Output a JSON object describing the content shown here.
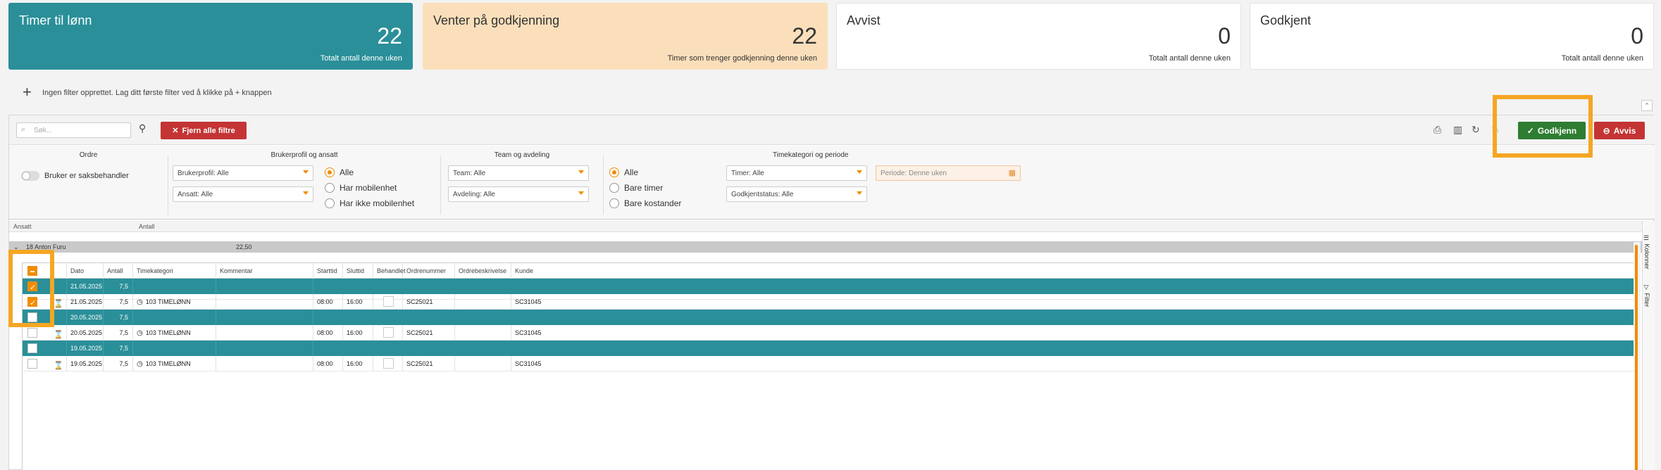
{
  "cards": [
    {
      "title": "Timer til lønn",
      "value": "22",
      "subtitle": "Totalt antall denne uken"
    },
    {
      "title": "Venter på godkjenning",
      "value": "22",
      "subtitle": "Timer som trenger godkjenning denne uken"
    },
    {
      "title": "Avvist",
      "value": "0",
      "subtitle": "Totalt antall denne uken"
    },
    {
      "title": "Godkjent",
      "value": "0",
      "subtitle": "Totalt antall denne uken"
    }
  ],
  "filter_notice": "Ingen filter opprettet. Lag ditt første filter ved å klikke på + knappen",
  "toolbar": {
    "search_placeholder": "Søk...",
    "clear_filters_label": "Fjern alle filtre",
    "approve_label": "Godkjenn",
    "reject_label": "Avvis"
  },
  "filters": {
    "ordre": {
      "heading": "Ordre",
      "toggle_label": "Bruker er saksbehandler"
    },
    "bruker": {
      "heading": "Brukerprofil og ansatt",
      "profile_select": "Brukerprofil: Alle",
      "employee_select": "Ansatt: Alle",
      "radios": [
        "Alle",
        "Har mobilenhet",
        "Har ikke mobilenhet"
      ]
    },
    "team": {
      "heading": "Team og avdeling",
      "team_select": "Team: Alle",
      "dept_select": "Avdeling: Alle"
    },
    "time": {
      "heading": "Timekategori og periode",
      "radios": [
        "Alle",
        "Bare timer",
        "Bare kostander"
      ],
      "timer_select": "Timer: Alle",
      "status_select": "Godkjentstatus: Alle",
      "period_select": "Periode: Denne uken"
    }
  },
  "group_header": {
    "col1": "Ansatt",
    "col2": "Antall"
  },
  "group_row": {
    "name": "18 Anton Furu",
    "total": "22,50"
  },
  "table": {
    "columns": [
      "Dato",
      "Antall",
      "Timekategori",
      "Kommentar",
      "Starttid",
      "Sluttid",
      "Behandlet",
      "Ordrenummer",
      "Ordrebeskrivelse",
      "Kunde"
    ],
    "rows": [
      {
        "type": "summary",
        "checked": true,
        "date": "21.05.2025",
        "amount": "7,5"
      },
      {
        "type": "detail",
        "checked": true,
        "date": "21.05.2025",
        "amount": "7,5",
        "category": "103 TIMELØNN",
        "start": "08:00",
        "end": "16:00",
        "order": "SC25021",
        "customer": "SC31045"
      },
      {
        "type": "summary",
        "checked": false,
        "date": "20.05.2025",
        "amount": "7,5"
      },
      {
        "type": "detail",
        "checked": false,
        "date": "20.05.2025",
        "amount": "7,5",
        "category": "103 TIMELØNN",
        "start": "08:00",
        "end": "16:00",
        "order": "SC25021",
        "customer": "SC31045"
      },
      {
        "type": "summary",
        "checked": false,
        "date": "19.05.2025",
        "amount": "7,5"
      },
      {
        "type": "detail",
        "checked": false,
        "date": "19.05.2025",
        "amount": "7,5",
        "category": "103 TIMELØNN",
        "start": "08:00",
        "end": "16:00",
        "order": "SC25021",
        "customer": "SC31045"
      }
    ]
  },
  "rail": {
    "columns_label": "Kolonner",
    "filter_label": "Filter"
  },
  "colors": {
    "teal": "#2a8f99",
    "orange": "#f08c00",
    "green": "#2e7d32",
    "red": "#c43434",
    "peach": "#fbdfbb"
  }
}
